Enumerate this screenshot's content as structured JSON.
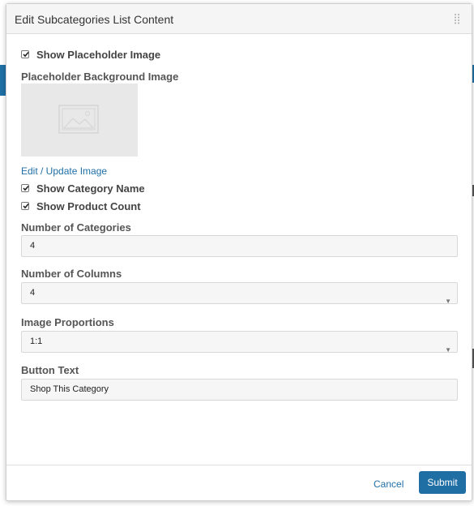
{
  "modal": {
    "title": "Edit Subcategories List Content"
  },
  "form": {
    "show_placeholder": {
      "label": "Show Placeholder Image",
      "checked": true
    },
    "placeholder_bg": {
      "label": "Placeholder Background Image",
      "icon": "image-placeholder-icon"
    },
    "edit_image_link": "Edit / Update Image",
    "show_category_name": {
      "label": "Show Category Name",
      "checked": true
    },
    "show_product_count": {
      "label": "Show Product Count",
      "checked": true
    },
    "num_categories": {
      "label": "Number of Categories",
      "value": "4"
    },
    "num_columns": {
      "label": "Number of Columns",
      "value": "4"
    },
    "image_proportions": {
      "label": "Image Proportions",
      "value": "1:1"
    },
    "button_text": {
      "label": "Button Text",
      "value": "Shop This Category"
    }
  },
  "footer": {
    "cancel_label": "Cancel",
    "submit_label": "Submit"
  },
  "colors": {
    "accent": "#1f6fa5",
    "header_bg": "#f5f5f5",
    "input_bg": "#f6f6f6"
  }
}
